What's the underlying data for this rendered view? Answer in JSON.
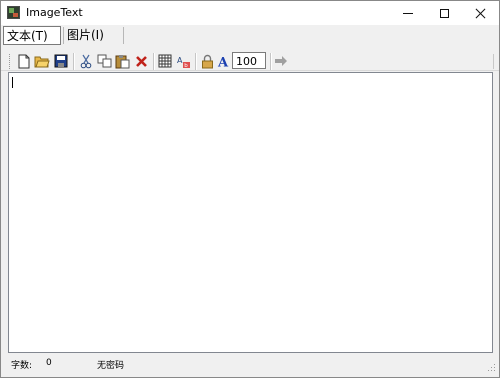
{
  "window": {
    "title": "ImageText"
  },
  "tabs": [
    {
      "label": "文本(T)",
      "selected": true
    },
    {
      "label": "图片(I)",
      "selected": false
    }
  ],
  "toolbar": {
    "items": [
      "new-file",
      "open-folder",
      "save",
      "cut",
      "copy",
      "paste",
      "delete",
      "grid",
      "replace",
      "lock",
      "font",
      "zoom-input",
      "go-arrow"
    ],
    "zoom_value": "100"
  },
  "editor": {
    "value": ""
  },
  "statusbar": {
    "char_label": "字数:",
    "char_count": "0",
    "password_status": "无密码"
  }
}
